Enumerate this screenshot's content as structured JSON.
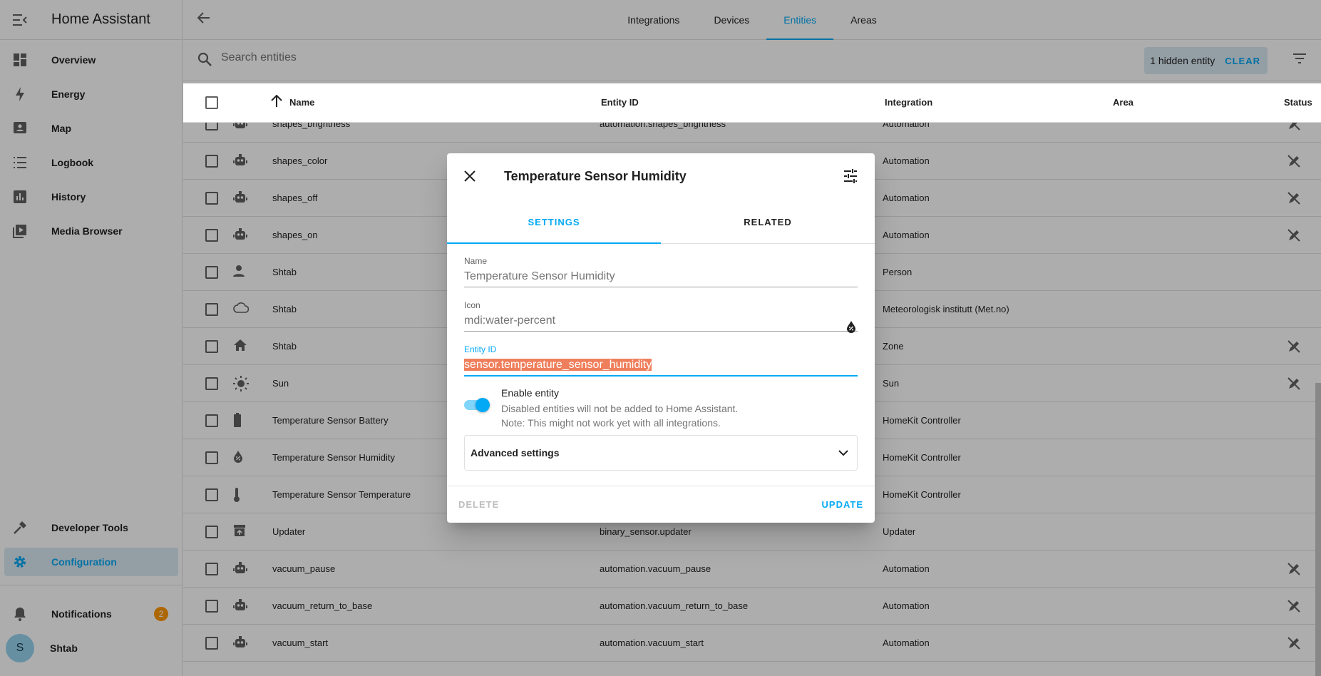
{
  "sidebar": {
    "title": "Home Assistant",
    "items": [
      {
        "label": "Overview",
        "icon": "view-dashboard-icon"
      },
      {
        "label": "Energy",
        "icon": "lightning-icon"
      },
      {
        "label": "Map",
        "icon": "map-icon"
      },
      {
        "label": "Logbook",
        "icon": "list-icon"
      },
      {
        "label": "History",
        "icon": "chart-box-icon"
      },
      {
        "label": "Media Browser",
        "icon": "play-box-icon"
      }
    ],
    "bottom_items": [
      {
        "label": "Developer Tools",
        "icon": "hammer-icon"
      },
      {
        "label": "Configuration",
        "icon": "cog-icon"
      }
    ],
    "notifications": {
      "label": "Notifications",
      "count": "2"
    },
    "user": {
      "label": "Shtab",
      "initial": "S"
    }
  },
  "header": {
    "tabs": [
      "Integrations",
      "Devices",
      "Entities",
      "Areas"
    ],
    "active_tab": "Entities"
  },
  "search": {
    "placeholder": "Search entities",
    "hidden_chip": "1 hidden entity",
    "clear_label": "CLEAR"
  },
  "table": {
    "columns": [
      "Name",
      "Entity ID",
      "Integration",
      "Area",
      "Status"
    ],
    "rows": [
      {
        "icon": "robot-icon",
        "name": "shapes_brightness",
        "entity_id": "automation.shapes_brightness",
        "integration": "Automation",
        "status": "pencil-off"
      },
      {
        "icon": "robot-icon",
        "name": "shapes_color",
        "entity_id": "",
        "integration": "Automation",
        "status": "pencil-off"
      },
      {
        "icon": "robot-icon",
        "name": "shapes_off",
        "entity_id": "",
        "integration": "Automation",
        "status": "pencil-off"
      },
      {
        "icon": "robot-icon",
        "name": "shapes_on",
        "entity_id": "",
        "integration": "Automation",
        "status": "pencil-off"
      },
      {
        "icon": "person-icon",
        "name": "Shtab",
        "entity_id": "",
        "integration": "Person",
        "status": ""
      },
      {
        "icon": "cloud-icon",
        "name": "Shtab",
        "entity_id": "",
        "integration": "Meteorologisk institutt (Met.no)",
        "status": ""
      },
      {
        "icon": "home-icon",
        "name": "Shtab",
        "entity_id": "",
        "integration": "Zone",
        "status": "pencil-off"
      },
      {
        "icon": "sun-icon",
        "name": "Sun",
        "entity_id": "",
        "integration": "Sun",
        "status": "pencil-off"
      },
      {
        "icon": "battery-icon",
        "name": "Temperature Sensor Battery",
        "entity_id": "",
        "integration": "HomeKit Controller",
        "status": ""
      },
      {
        "icon": "water-percent-icon",
        "name": "Temperature Sensor Humidity",
        "entity_id": "",
        "integration": "HomeKit Controller",
        "status": ""
      },
      {
        "icon": "thermometer-icon",
        "name": "Temperature Sensor Temperature",
        "entity_id": "",
        "integration": "HomeKit Controller",
        "status": ""
      },
      {
        "icon": "package-up-icon",
        "name": "Updater",
        "entity_id": "binary_sensor.updater",
        "integration": "Updater",
        "status": ""
      },
      {
        "icon": "robot-icon",
        "name": "vacuum_pause",
        "entity_id": "automation.vacuum_pause",
        "integration": "Automation",
        "status": "pencil-off"
      },
      {
        "icon": "robot-icon",
        "name": "vacuum_return_to_base",
        "entity_id": "automation.vacuum_return_to_base",
        "integration": "Automation",
        "status": "pencil-off"
      },
      {
        "icon": "robot-icon",
        "name": "vacuum_start",
        "entity_id": "automation.vacuum_start",
        "integration": "Automation",
        "status": "pencil-off"
      }
    ]
  },
  "dialog": {
    "title": "Temperature Sensor Humidity",
    "tabs": [
      "SETTINGS",
      "RELATED"
    ],
    "active_tab": "SETTINGS",
    "name_label": "Name",
    "name_value": "Temperature Sensor Humidity",
    "icon_label": "Icon",
    "icon_value": "mdi:water-percent",
    "entity_id_label": "Entity ID",
    "entity_id_value": "sensor.temperature_sensor_humidity",
    "enable_title": "Enable entity",
    "enable_desc_1": "Disabled entities will not be added to Home Assistant.",
    "enable_desc_2": "Note: This might not work yet with all integrations.",
    "enabled": true,
    "advanced_label": "Advanced settings",
    "delete_label": "DELETE",
    "update_label": "UPDATE"
  },
  "colors": {
    "accent": "#03a9f4",
    "selection": "#ef7f5c",
    "badge": "#ff9800"
  }
}
